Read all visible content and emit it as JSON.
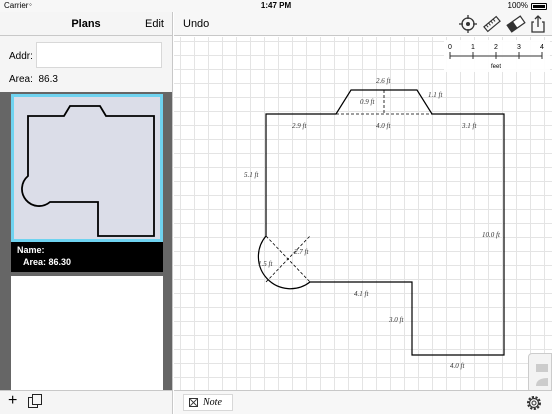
{
  "status": {
    "carrier": "Carrier",
    "time": "1:47 PM",
    "battery": "100%"
  },
  "sidebar": {
    "title": "Plans",
    "edit_label": "Edit",
    "addr_label": "Addr:",
    "addr_value": "",
    "area_label": "Area:",
    "area_value": "86.3",
    "plans": [
      {
        "name_label": "Name:",
        "name_value": "",
        "area_label": "Area:",
        "area_value": "86.30"
      }
    ]
  },
  "main": {
    "undo_label": "Undo",
    "note_label": "Note",
    "scale": {
      "ticks": [
        "0",
        "1",
        "2",
        "3",
        "4"
      ],
      "unit": "feet"
    },
    "dimensions": [
      "2.6 ft",
      "0.9 ft",
      "1.1 ft",
      "2.9 ft",
      "4.0 ft",
      "3.1 ft",
      "5.1 ft",
      "10.0 ft",
      "2.7 ft",
      "1.5 ft",
      "4.1 ft",
      "3.0 ft",
      "4.0 ft"
    ],
    "icons": [
      "target-icon",
      "ruler-icon",
      "eraser-icon",
      "share-icon",
      "gear-icon"
    ]
  },
  "colors": {
    "thumb_border": "#6fd3f0",
    "thumb_fill": "#dbdde8",
    "sidebar_dark": "#666666"
  }
}
